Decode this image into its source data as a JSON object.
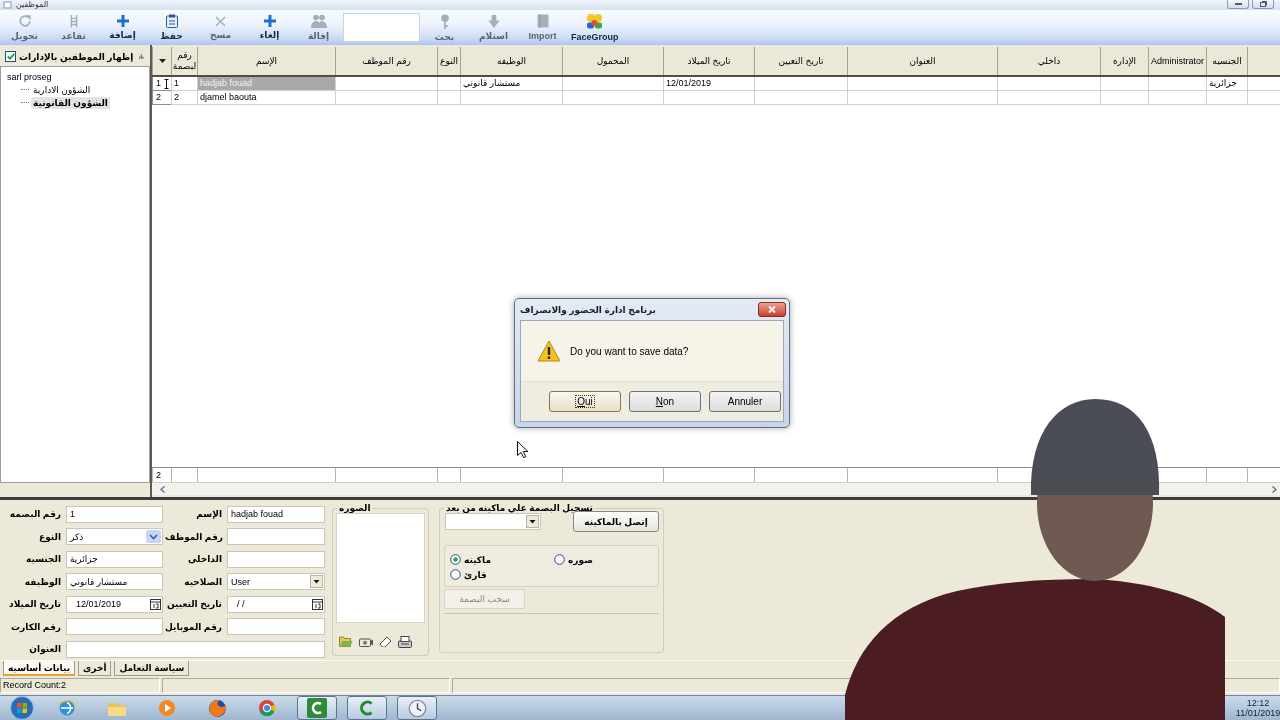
{
  "window": {
    "title": "الموظفين"
  },
  "toolbar": {
    "items": [
      {
        "kind": "button",
        "label": "FaceGroup",
        "disabled": false
      },
      {
        "kind": "button",
        "label": "Import",
        "disabled": true
      },
      {
        "kind": "button",
        "label": "استلام",
        "disabled": true
      },
      {
        "kind": "button",
        "label": "بحث",
        "disabled": true
      },
      {
        "kind": "field"
      },
      {
        "kind": "button",
        "label": "إقالة",
        "disabled": true
      },
      {
        "kind": "button",
        "label": "إلغاء",
        "disabled": false
      },
      {
        "kind": "button",
        "label": "مسح",
        "disabled": true
      },
      {
        "kind": "button",
        "label": "حفظ",
        "disabled": false
      },
      {
        "kind": "button",
        "label": "إضافة",
        "disabled": false
      },
      {
        "kind": "button",
        "label": "تقاعد",
        "disabled": true
      },
      {
        "kind": "button",
        "label": "تحويل",
        "disabled": true
      }
    ]
  },
  "employee_tree": {
    "show_by_department": {
      "label": "إظهار الموظفين بالإدارات",
      "checked": true
    },
    "items": [
      {
        "label": "sarl proseg",
        "selected": false,
        "children": [
          {
            "label": "الشؤون الادارية",
            "selected": false
          },
          {
            "label": "الشؤون القانونية",
            "selected": true
          }
        ]
      }
    ]
  },
  "grid": {
    "columns": [
      "الجنسيه",
      "Administrator",
      "الإداره",
      "داخلي",
      "العنوان",
      "تاريخ التعيين",
      "تاريخ الميلاد",
      "المحمول",
      "الوظيفه",
      "النوع",
      "رقم الموظف",
      "الإسم",
      "رقم لبصمة"
    ],
    "rows": [
      {
        "indicator": "1",
        "editing": true,
        "cells": [
          {
            "text": "جزائرية",
            "selected": false
          },
          null,
          null,
          null,
          null,
          null,
          {
            "text": "12/01/2019",
            "selected": false
          },
          null,
          {
            "text": "مستشار قانوني",
            "selected": false
          },
          null,
          null,
          {
            "text": "hadjab fouad",
            "selected": true
          },
          {
            "text": "1",
            "selected": false
          }
        ]
      },
      {
        "indicator": "2",
        "editing": false,
        "cells": [
          null,
          null,
          null,
          null,
          null,
          null,
          null,
          null,
          null,
          null,
          null,
          {
            "text": "djamel baouta",
            "selected": false
          },
          {
            "text": "2",
            "selected": false
          }
        ]
      }
    ],
    "footer_count": "2"
  },
  "dialog": {
    "title": "برنامج ادارة الحضور والانصراف",
    "message": "Do you want to save data?",
    "buttons": [
      {
        "label": "Annuler",
        "focused": false,
        "mnemonic": false
      },
      {
        "label": "Non",
        "focused": false,
        "mnemonic": true
      },
      {
        "label": "Oui",
        "focused": true,
        "mnemonic": true
      }
    ]
  },
  "form": {
    "left_column": [
      {
        "label": "رقم البصمه",
        "kind": "text",
        "value": "1"
      },
      {
        "label": "النوع",
        "kind": "dropdown",
        "value": "ذكر"
      },
      {
        "label": "الجنسيه",
        "kind": "text",
        "value": "جزائرية"
      },
      {
        "label": "الوظيفه",
        "kind": "text",
        "value": "مستشار قانوني"
      },
      {
        "label": "تاريخ الميلاد",
        "kind": "date",
        "value": "12/01/2019"
      },
      {
        "label": "رقم الكارت",
        "kind": "text"
      }
    ],
    "right_column": [
      {
        "label": "الإسم",
        "kind": "text",
        "value": "hadjab fouad"
      },
      {
        "label": "رقم الموظف",
        "kind": "text"
      },
      {
        "label": "الداخلي",
        "kind": "text"
      },
      {
        "label": "الصلاحيه",
        "kind": "select",
        "value": "User"
      },
      {
        "label": "تاريخ التعيين",
        "kind": "date",
        "value": "/ /"
      },
      {
        "label": "رقم الموبايل",
        "kind": "text"
      }
    ],
    "address": {
      "label": "العنوان",
      "kind": "text"
    }
  },
  "photo": {
    "title": "الصوره"
  },
  "fingerprint": {
    "title": "تسجيل البصمة علي ماكينه من بعد",
    "connect_button": "إتصل بالماكينه",
    "source_options": [
      {
        "label": "ماكينه",
        "selected": true
      },
      {
        "label": "صوره",
        "selected": false
      },
      {
        "label": "قارئ",
        "selected": false
      }
    ],
    "pull_button": {
      "label": "سحب البصمة",
      "disabled": true
    }
  },
  "tabs": [
    {
      "label": "سياسة التعامل",
      "selected": false
    },
    {
      "label": "أخرى",
      "selected": false
    },
    {
      "label": "بيانات أساسيه",
      "selected": true
    }
  ],
  "status_bar": {
    "record_count": "Record Count:2"
  },
  "taskbar": {
    "apps": [
      {
        "running": false
      },
      {
        "running": false
      },
      {
        "running": false
      },
      {
        "running": false
      },
      {
        "running": false
      },
      {
        "running": true
      },
      {
        "running": true
      },
      {
        "running": true
      }
    ],
    "clock": {
      "time": "12:12",
      "date": "11/01/2019"
    }
  }
}
